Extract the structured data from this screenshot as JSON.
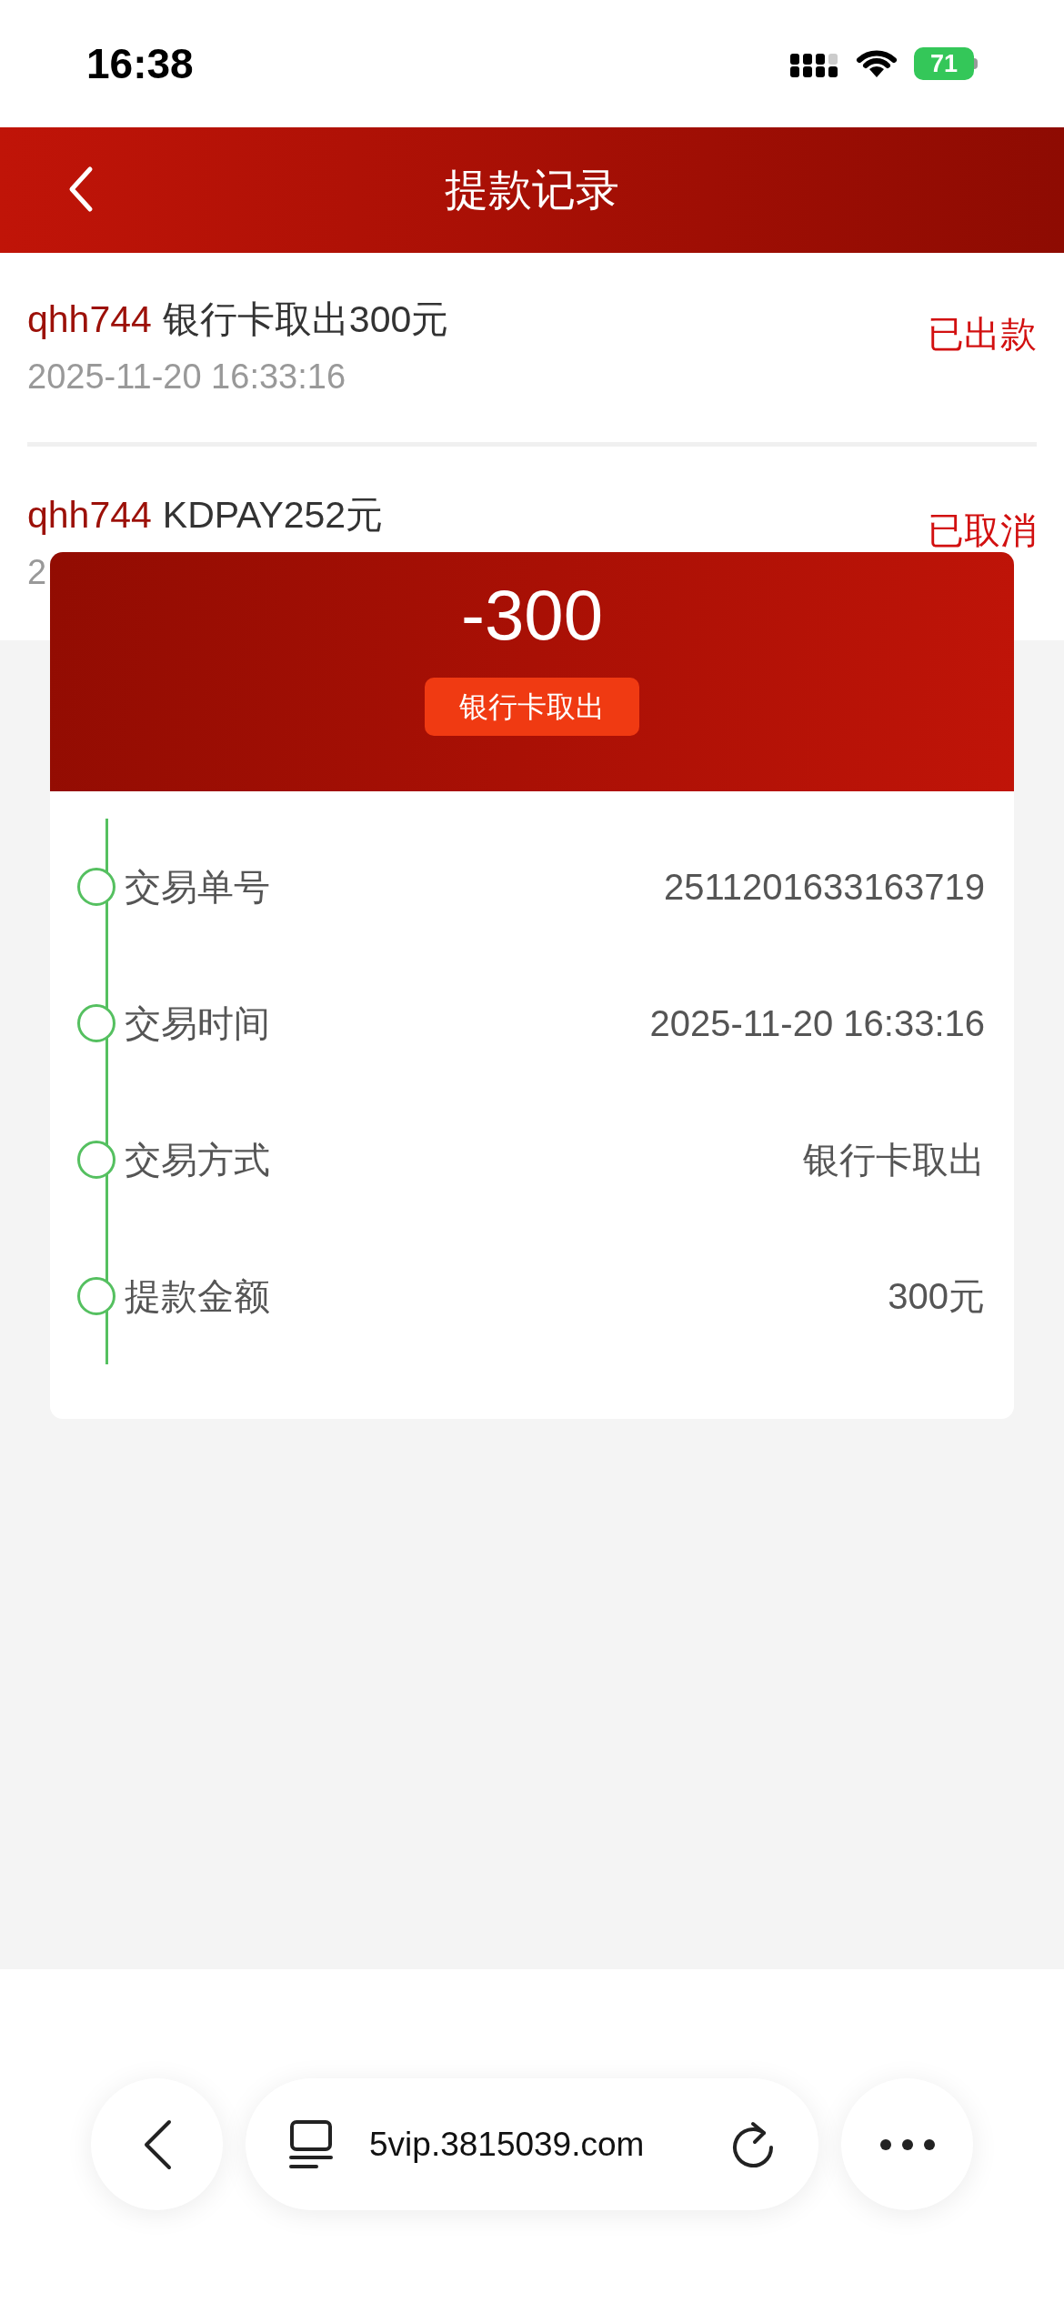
{
  "status_bar": {
    "time": "16:38",
    "battery": "71"
  },
  "header": {
    "title": "提款记录"
  },
  "records": [
    {
      "user": "qhh744",
      "desc": "银行卡取出300元",
      "time": "2025-11-20 16:33:16",
      "status": "已出款"
    },
    {
      "user": "qhh744",
      "desc": "KDPAY252元",
      "time": "2",
      "status": "已取消"
    }
  ],
  "detail": {
    "amount": "-300",
    "method_tag": "银行卡取出",
    "rows": [
      {
        "label": "交易单号",
        "value": "2511201633163719"
      },
      {
        "label": "交易时间",
        "value": "2025-11-20 16:33:16"
      },
      {
        "label": "交易方式",
        "value": "银行卡取出"
      },
      {
        "label": "提款金额",
        "value": "300元"
      }
    ]
  },
  "browser": {
    "url": "5vip.3815039.com"
  }
}
